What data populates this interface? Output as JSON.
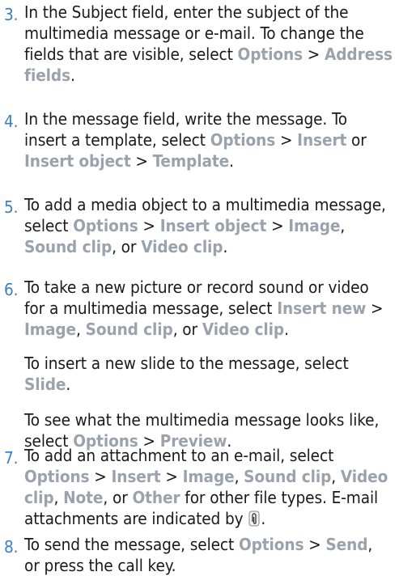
{
  "steps": [
    {
      "number": "3.",
      "lines": [
        [
          {
            "t": "In the Subject field, enter the subject of the",
            "u": false
          }
        ],
        [
          {
            "t": "multimedia message or e-mail. To change the",
            "u": false
          }
        ],
        [
          {
            "t": "fields that are visible, select ",
            "u": false
          },
          {
            "t": "Options",
            "u": true
          },
          {
            "t": " > ",
            "u": false
          },
          {
            "t": "Address",
            "u": true
          }
        ],
        [
          {
            "t": "fields",
            "u": true
          },
          {
            "t": ".",
            "u": false
          }
        ]
      ]
    },
    {
      "number": "4.",
      "lines": [
        [
          {
            "t": "In the message field, write the message. To",
            "u": false
          }
        ],
        [
          {
            "t": "insert a template, select ",
            "u": false
          },
          {
            "t": "Options",
            "u": true
          },
          {
            "t": " > ",
            "u": false
          },
          {
            "t": "Insert",
            "u": true
          },
          {
            "t": " or",
            "u": false
          }
        ],
        [
          {
            "t": "Insert object",
            "u": true
          },
          {
            "t": " > ",
            "u": false
          },
          {
            "t": "Template",
            "u": true
          },
          {
            "t": ".",
            "u": false
          }
        ]
      ]
    },
    {
      "number": "5.",
      "lines": [
        [
          {
            "t": "To add a media object to a multimedia message,",
            "u": false
          }
        ],
        [
          {
            "t": "select ",
            "u": false
          },
          {
            "t": "Options",
            "u": true
          },
          {
            "t": " > ",
            "u": false
          },
          {
            "t": "Insert object",
            "u": true
          },
          {
            "t": " > ",
            "u": false
          },
          {
            "t": "Image",
            "u": true
          },
          {
            "t": ",",
            "u": false
          }
        ],
        [
          {
            "t": "Sound clip",
            "u": true
          },
          {
            "t": ", or ",
            "u": false
          },
          {
            "t": "Video clip",
            "u": true
          },
          {
            "t": ".",
            "u": false
          }
        ]
      ]
    },
    {
      "number": "6.",
      "lines": [
        [
          {
            "t": "To take a new picture or record sound or video",
            "u": false
          }
        ],
        [
          {
            "t": "for a multimedia message, select ",
            "u": false
          },
          {
            "t": "Insert new",
            "u": true
          },
          {
            "t": " >",
            "u": false
          }
        ],
        [
          {
            "t": "Image",
            "u": true
          },
          {
            "t": ", ",
            "u": false
          },
          {
            "t": "Sound clip",
            "u": true
          },
          {
            "t": ", or ",
            "u": false
          },
          {
            "t": "Video clip",
            "u": true
          },
          {
            "t": ".",
            "u": false
          }
        ]
      ],
      "paragraphs": [
        [
          [
            {
              "t": "To insert a new slide to the message, select",
              "u": false
            }
          ],
          [
            {
              "t": "Slide",
              "u": true
            },
            {
              "t": ".",
              "u": false
            }
          ]
        ],
        [
          [
            {
              "t": "To see what the multimedia message looks like,",
              "u": false
            }
          ],
          [
            {
              "t": "select ",
              "u": false
            },
            {
              "t": "Options",
              "u": true
            },
            {
              "t": " > ",
              "u": false
            },
            {
              "t": "Preview",
              "u": true
            },
            {
              "t": ".",
              "u": false
            }
          ]
        ]
      ]
    },
    {
      "number": "7.",
      "lines": [
        [
          {
            "t": "To add an attachment to an e-mail, select",
            "u": false
          }
        ],
        [
          {
            "t": "Options",
            "u": true
          },
          {
            "t": " > ",
            "u": false
          },
          {
            "t": "Insert",
            "u": true
          },
          {
            "t": " > ",
            "u": false
          },
          {
            "t": "Image",
            "u": true
          },
          {
            "t": ", ",
            "u": false
          },
          {
            "t": "Sound clip",
            "u": true
          },
          {
            "t": ", ",
            "u": false
          },
          {
            "t": "Video",
            "u": true
          }
        ],
        [
          {
            "t": "clip",
            "u": true
          },
          {
            "t": ", ",
            "u": false
          },
          {
            "t": "Note",
            "u": true
          },
          {
            "t": ", or ",
            "u": false
          },
          {
            "t": "Other",
            "u": true
          },
          {
            "t": " for other file types. E-mail",
            "u": false
          }
        ],
        [
          {
            "t": "attachments are indicated by ",
            "u": false
          },
          {
            "icon": "paperclip-icon"
          },
          {
            "t": ".",
            "u": false
          }
        ]
      ]
    },
    {
      "number": "8.",
      "lines": [
        [
          {
            "t": "To send the message, select ",
            "u": false
          },
          {
            "t": "Options",
            "u": true
          },
          {
            "t": " > ",
            "u": false
          },
          {
            "t": "Send",
            "u": true
          },
          {
            "t": ",",
            "u": false
          }
        ],
        [
          {
            "t": "or press the call key.",
            "u": false
          }
        ]
      ]
    }
  ],
  "colors": {
    "step_number": "#3a7fc9",
    "ui_term": "#9aa3ad",
    "text": "#1a1a1a"
  }
}
